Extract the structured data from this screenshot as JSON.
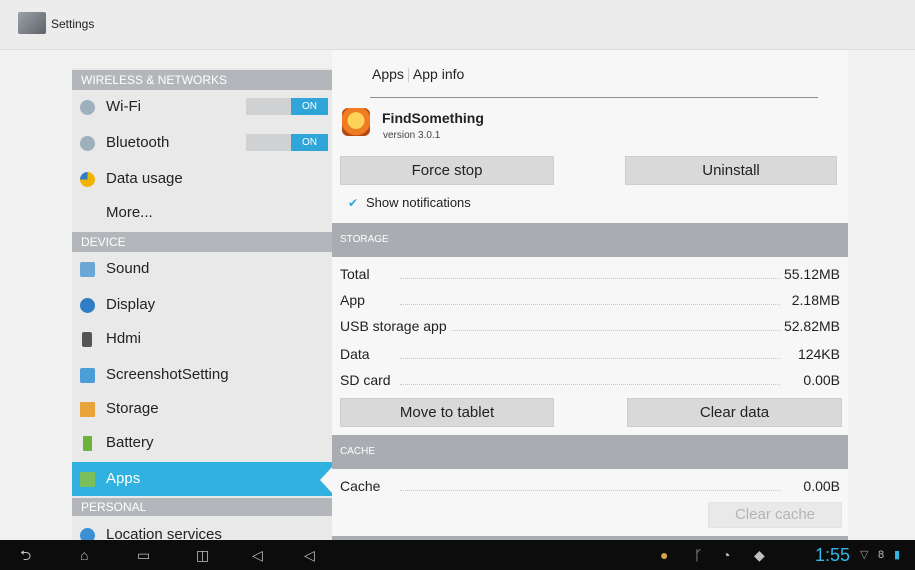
{
  "app": {
    "title": "Settings"
  },
  "sidebar": {
    "sections": [
      "WIRELESS & NETWORKS",
      "DEVICE",
      "PERSONAL"
    ],
    "items": [
      {
        "label": "Wi-Fi",
        "toggle": "ON",
        "icon": "wifi-icon"
      },
      {
        "label": "Bluetooth",
        "toggle": "ON",
        "icon": "bluetooth-icon"
      },
      {
        "label": "Data usage",
        "icon": "data-usage-icon"
      },
      {
        "label": "More..."
      },
      {
        "label": "Sound",
        "icon": "sound-icon"
      },
      {
        "label": "Display",
        "icon": "display-icon"
      },
      {
        "label": "Hdmi",
        "icon": "hdmi-icon"
      },
      {
        "label": "ScreenshotSetting",
        "icon": "screenshot-icon"
      },
      {
        "label": "Storage",
        "icon": "storage-icon"
      },
      {
        "label": "Battery",
        "icon": "battery-icon"
      },
      {
        "label": "Apps",
        "icon": "apps-icon",
        "selected": true
      },
      {
        "label": "Location services",
        "icon": "location-icon"
      }
    ]
  },
  "main": {
    "breadcrumb": [
      "Apps",
      "App info"
    ],
    "app_name": "FindSomething",
    "app_version": "version 3.0.1",
    "force_stop": "Force stop",
    "uninstall": "Uninstall",
    "show_notifications": "Show notifications",
    "storage_header": "STORAGE",
    "storage_rows": [
      {
        "label": "Total",
        "value": "55.12MB"
      },
      {
        "label": "App",
        "value": "2.18MB"
      },
      {
        "label": "USB storage app",
        "value": "52.82MB"
      },
      {
        "label": "Data",
        "value": "124KB"
      },
      {
        "label": "SD card",
        "value": "0.00B"
      }
    ],
    "move_to_tablet": "Move to tablet",
    "clear_data": "Clear data",
    "cache_header": "CACHE",
    "cache_label": "Cache",
    "cache_value": "0.00B",
    "clear_cache": "Clear cache"
  },
  "navbar": {
    "time": "1:55"
  },
  "colors": {
    "accent": "#31b1e0",
    "clock": "#33b5e5"
  }
}
